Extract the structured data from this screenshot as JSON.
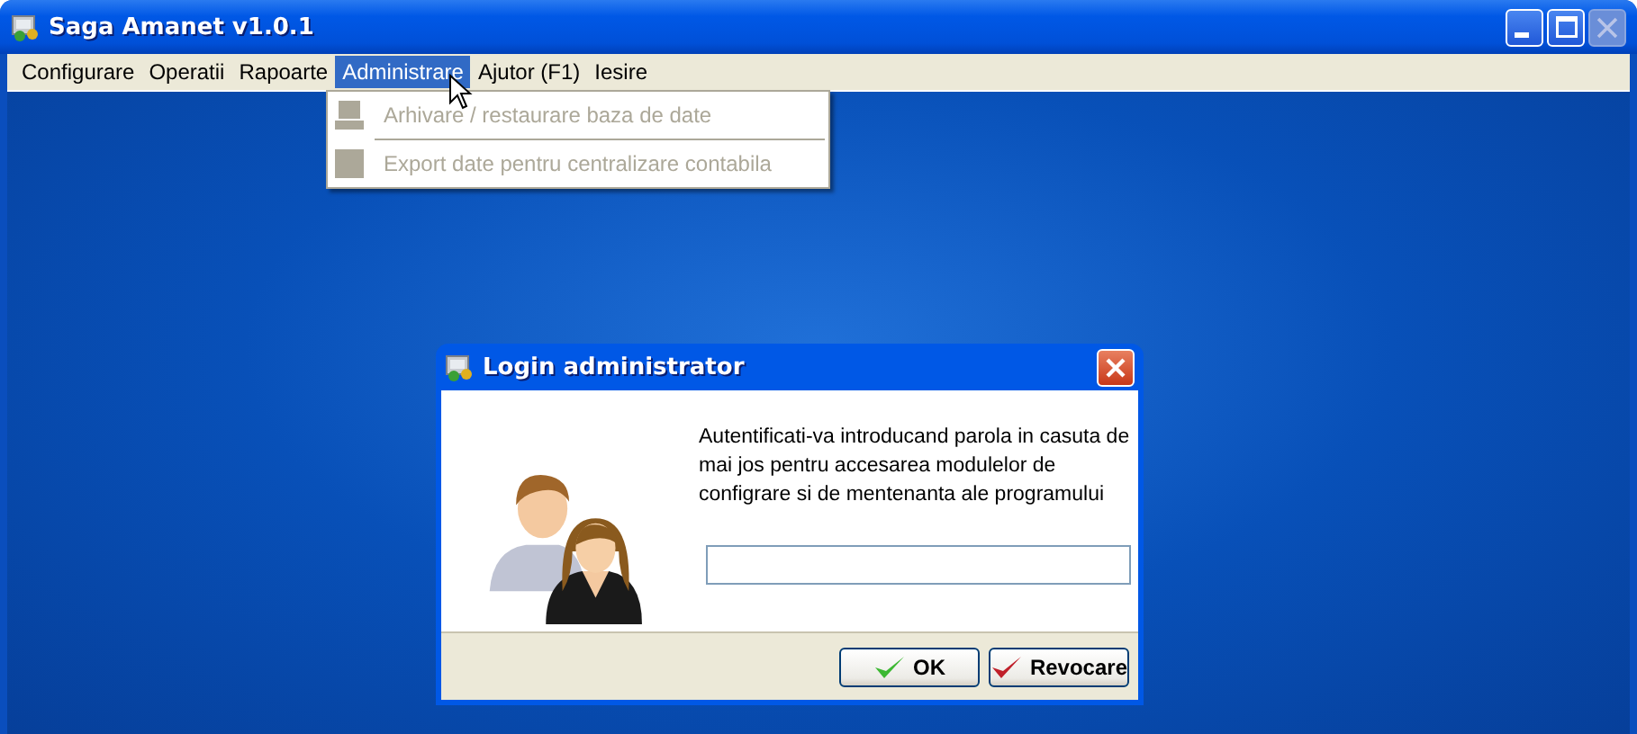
{
  "window": {
    "title": "Saga Amanet v1.0.1",
    "close_disabled": true
  },
  "menu": [
    {
      "label": "Configurare",
      "selected": false
    },
    {
      "label": "Operatii",
      "selected": false
    },
    {
      "label": "Rapoarte",
      "selected": false
    },
    {
      "label": "Administrare",
      "selected": true
    },
    {
      "label": "Ajutor (F1)",
      "selected": false
    },
    {
      "label": "Iesire",
      "selected": false
    }
  ],
  "dropdown": [
    {
      "label": "Arhivare / restaurare baza de date",
      "disabled": true
    },
    {
      "label": "Export date pentru centralizare contabila",
      "disabled": true
    }
  ],
  "dialog": {
    "title": "Login administrator",
    "message": "Autentificati-va introducand parola in casuta de mai jos pentru accesarea modulelor de configrare si de mentenanta ale programului",
    "buttons": [
      {
        "label": "OK",
        "kind": "ok"
      },
      {
        "label": "Revocare",
        "kind": "cancel"
      }
    ]
  }
}
